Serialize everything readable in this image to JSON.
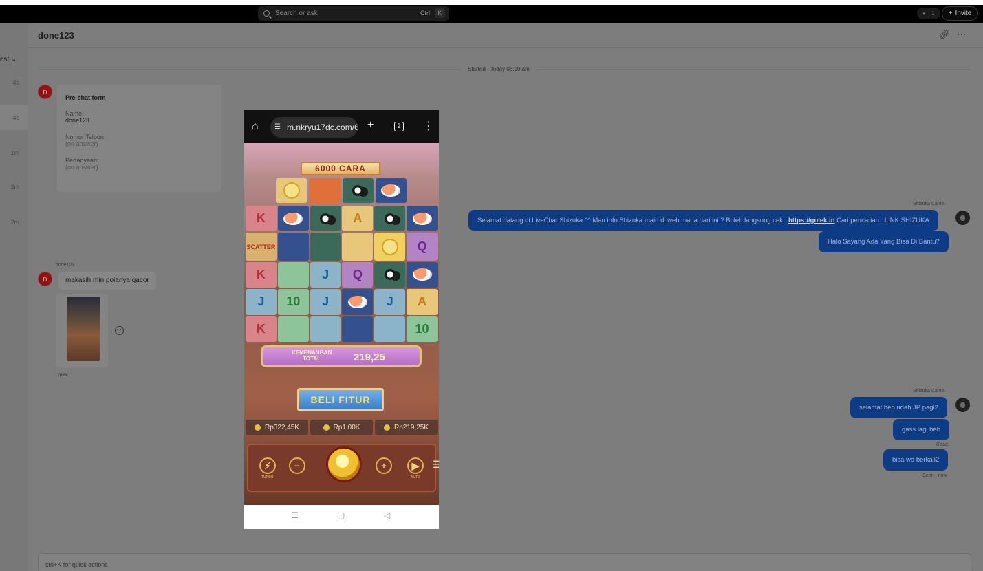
{
  "topbar": {
    "search_placeholder": "Search or ask",
    "shortcut_ctrl": "Ctrl",
    "shortcut_key": "K",
    "presence_count": "1",
    "invite_label": "Invite"
  },
  "sidebar": {
    "sort_label": "est",
    "times": [
      "4s",
      "4s",
      "1m",
      "2m",
      "2m"
    ]
  },
  "chat": {
    "title": "done123",
    "started": "Started - Today 08:20 am",
    "avatar_initial": "D",
    "prechat": {
      "title": "Pre-chat form",
      "name_label": "Name:",
      "name_value": "done123",
      "phone_label": "Nomor Telpon:",
      "phone_value": "(no answer)",
      "question_label": "Pertanyaan:",
      "question_value": "(no answer)"
    },
    "customer_name": "done123",
    "customer_message": "makasih min polanya gacor",
    "customer_time": "now",
    "agent_name_1": "Shizuka Cantik",
    "agent_msg_1_prefix": "Selamat datang di LiveChat Shizuka ^^ Mau info Shizuka main di web mana hari ini ? Boleh langsung cek : ",
    "agent_msg_1_link": "https://golek.in",
    "agent_msg_1_suffix": " Cari pencarian : LINK SHIZUKA",
    "agent_msg_2": "Halo Sayang Ada Yang Bisa Di Bantu?",
    "agent_name_2": "Shizuka Cantik",
    "agent_msg_3": "selamat beb udah JP pagi2",
    "agent_msg_4": "gass lagi beb",
    "read_label": "Read",
    "agent_msg_5": "bisa wd berkali2",
    "seen_label": "Seen · now",
    "composer_placeholder": "ctrl+K for quick actions"
  },
  "phone": {
    "url": "m.nkryu17dc.com/6",
    "tab_count": "2",
    "banner": "6000 CARA",
    "win_label_line1": "KEMENANGAN",
    "win_label_line2": "TOTAL",
    "win_value": "219,25",
    "buy_label": "BELI FITUR",
    "balance": "Rp322,45K",
    "bet": "Rp1,00K",
    "win": "Rp219,25K",
    "scatter_label": "SCATTER",
    "turbo_label": "TURBO",
    "auto_label": "AUTO"
  },
  "colors": {
    "agent_bubble": "#0d3b86",
    "customer_avatar": "#8b1414"
  }
}
